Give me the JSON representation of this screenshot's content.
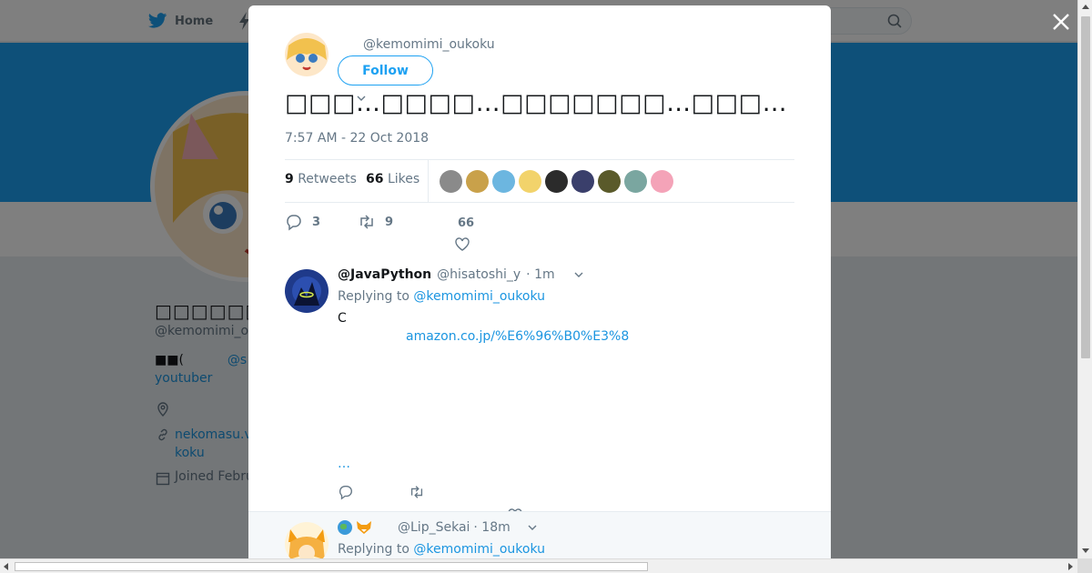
{
  "nav": {
    "home_label": "Home",
    "home_icon": "twitter-bird-icon",
    "search_icon": "search-icon"
  },
  "profile": {
    "name": "□□□□□□□□□",
    "handle": "@kemomimi_o",
    "bio_prefix": "■■(",
    "bio_mention": "@s",
    "bio_line2": "youtuber",
    "url": "nekomasu.v koku",
    "joined": "Joined Febru"
  },
  "colors": {
    "accent": "#1da1f2",
    "link": "#1b95e0",
    "muted": "#657786"
  },
  "tweet": {
    "handle": "@kemomimi_oukoku",
    "follow_label": "Follow",
    "text": "□□□…□□□□…□□□□□□□…□□□…",
    "timestamp": "7:57 AM - 22 Oct 2018",
    "retweets_count": "9",
    "retweets_label": "Retweets",
    "likes_count": "66",
    "likes_label": "Likes",
    "reply_count": "3",
    "retweet_action_count": "9",
    "like_action_count": "66",
    "likers": [
      "#8a8a8a",
      "#c9a14a",
      "#6cb6e0",
      "#f2d36b",
      "#2b2b2b",
      "#3a3f6b",
      "#5a5a2a",
      "#7aa6a0",
      "#f4a3b8"
    ]
  },
  "replies": [
    {
      "name": "@JavaPython",
      "handle": "@hisatoshi_y",
      "time": "· 1m",
      "replying_prefix": "Replying to",
      "replying_to": "@kemomimi_oukoku",
      "body": "C",
      "link": "amazon.co.jp/%E6%96%B0%E3%8",
      "more": "…"
    },
    {
      "name": "",
      "handle": "@Lip_Sekai",
      "time": "· 18m",
      "replying_prefix": "Replying to",
      "replying_to": "@kemomimi_oukoku"
    }
  ]
}
